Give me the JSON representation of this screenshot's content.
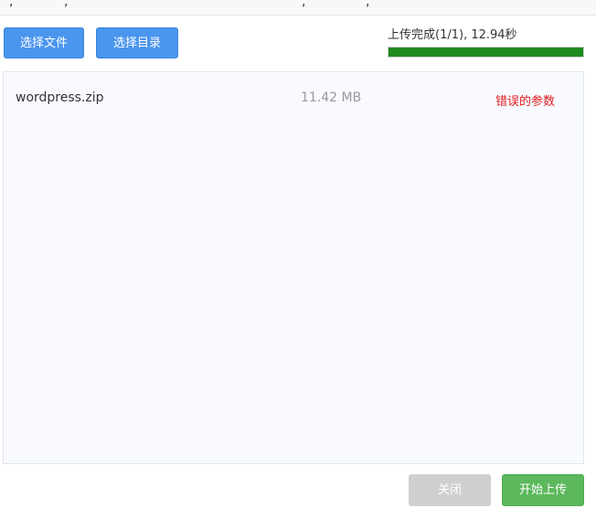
{
  "toolbar": {
    "select_file_label": "选择文件",
    "select_dir_label": "选择目录"
  },
  "progress": {
    "text": "上传完成(1/1), 12.94秒",
    "fraction": 1.0,
    "color": "#1e8a1e"
  },
  "files": [
    {
      "name": "wordpress.zip",
      "size": "11.42 MB",
      "status": "错误的参数"
    }
  ],
  "footer": {
    "close_label": "关闭",
    "start_label": "开始上传"
  },
  "colors": {
    "primary_button": "#4a95ee",
    "success_button": "#5cb85c",
    "error_text": "#e21b1b"
  }
}
